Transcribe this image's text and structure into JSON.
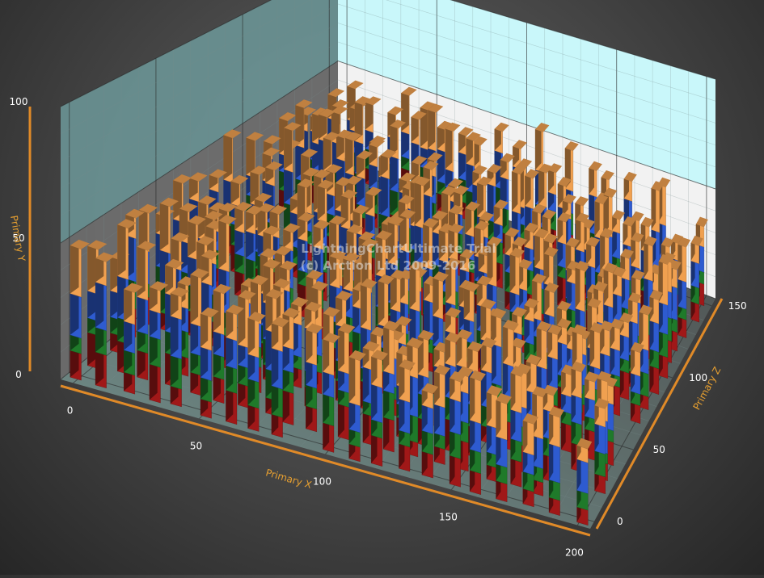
{
  "chart_data": {
    "type": "bar",
    "subtype": "3d-stacked-bar",
    "title": "",
    "xlabel": "Primary X",
    "ylabel": "Primary Y",
    "zlabel": "Primary Z",
    "xlim": [
      -5,
      205
    ],
    "ylim": [
      0,
      100
    ],
    "zlim": [
      -5,
      155
    ],
    "x_ticks": [
      0,
      50,
      100,
      150,
      200
    ],
    "y_ticks": [
      0,
      50,
      100
    ],
    "z_ticks": [
      0,
      50,
      100,
      150
    ],
    "grid": true,
    "legend": "none",
    "series": [
      {
        "name": "",
        "color": "#a01818"
      },
      {
        "name": "",
        "color": "#1f7a2a"
      },
      {
        "name": "",
        "color": "#2e5bd0"
      },
      {
        "name": "",
        "color": "#f0a050"
      }
    ],
    "columns_x": [
      0,
      10,
      20,
      30,
      40,
      50,
      60,
      70,
      80,
      90,
      100,
      110,
      120,
      130,
      140,
      150,
      160,
      170,
      180,
      190,
      200
    ],
    "rows_z": [
      0,
      10,
      20,
      30,
      40,
      50,
      60,
      70,
      80,
      90,
      100,
      110,
      120,
      130,
      140,
      150
    ],
    "value_range_note_free": true,
    "segment_values": {
      "series_1": [
        10,
        6,
        12
      ],
      "series_2": [
        8,
        5,
        11
      ],
      "series_3": [
        12,
        8,
        16
      ],
      "series_4": [
        12,
        6,
        18
      ]
    }
  },
  "watermark": {
    "line1": "LightningChartUltimate Trial",
    "line2": "(c) Arction Ltd 2009-2016"
  }
}
